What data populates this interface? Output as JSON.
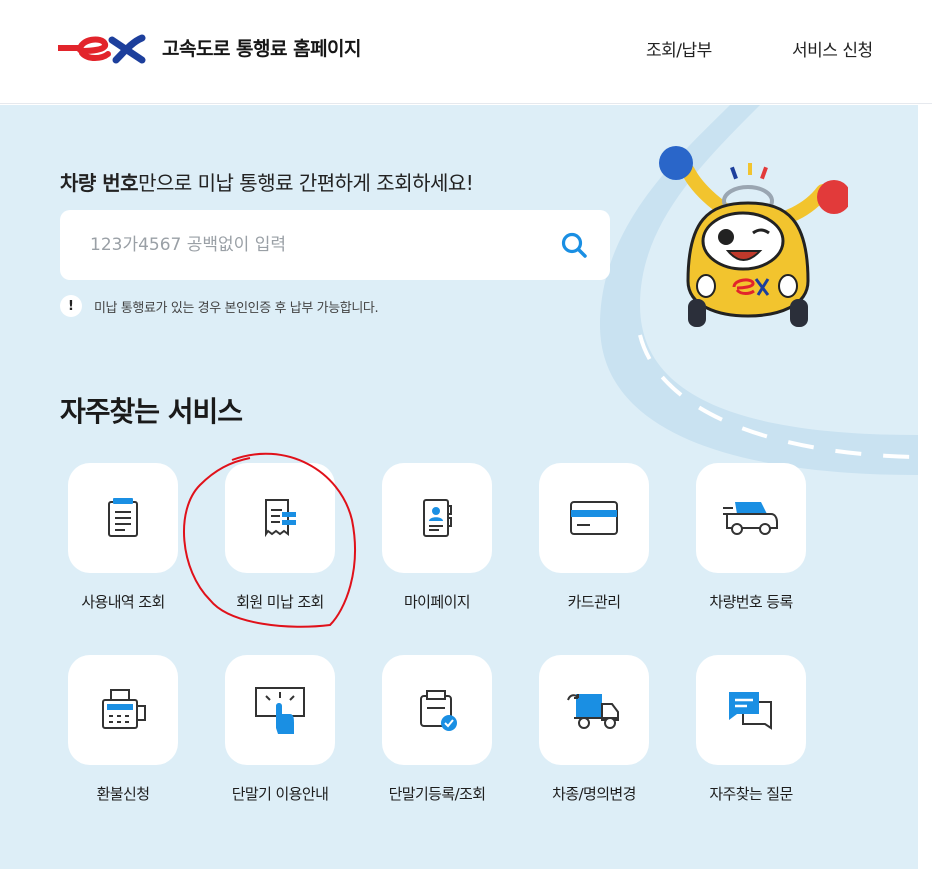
{
  "header": {
    "site_title": "고속도로 통행료 홈페이지",
    "nav": [
      "조회/납부",
      "서비스 신청"
    ]
  },
  "hero": {
    "headline_bold": "차량 번호",
    "headline_rest": "만으로 미납 통행료 간편하게 조회하세요!",
    "search_placeholder": "123가4567 공백없이 입력",
    "notice_icon": "!",
    "notice": "미납 통행료가 있는 경우 본인인증 후 납부 가능합니다."
  },
  "services": {
    "title": "자주찾는 서비스",
    "items": [
      {
        "label": "사용내역 조회",
        "icon": "receipt-list-icon"
      },
      {
        "label": "회원 미납 조회",
        "icon": "unpaid-bill-icon"
      },
      {
        "label": "마이페이지",
        "icon": "profile-card-icon"
      },
      {
        "label": "카드관리",
        "icon": "credit-card-icon"
      },
      {
        "label": "차량번호 등록",
        "icon": "car-icon"
      },
      {
        "label": "환불신청",
        "icon": "refund-machine-icon"
      },
      {
        "label": "단말기 이용안내",
        "icon": "touch-terminal-icon"
      },
      {
        "label": "단말기등록/조회",
        "icon": "terminal-check-icon"
      },
      {
        "label": "차종/명의변경",
        "icon": "truck-change-icon"
      },
      {
        "label": "자주찾는 질문",
        "icon": "chat-faq-icon"
      }
    ]
  },
  "colors": {
    "brand_red": "#e2242b",
    "brand_blue": "#1d3f9c",
    "accent_blue": "#1a8fe3",
    "hero_bg": "#ddeef7"
  }
}
